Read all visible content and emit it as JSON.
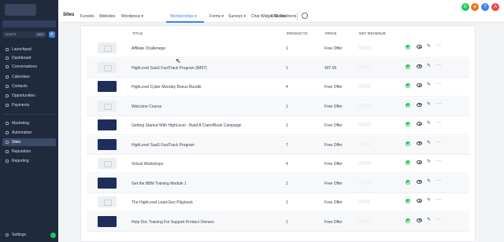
{
  "sidebar": {
    "search_placeholder": "Search",
    "search_shortcut": "ctrl K",
    "items": [
      {
        "label": "Launchpad",
        "icon": "rocket-icon"
      },
      {
        "label": "Dashboard",
        "icon": "dashboard-icon"
      },
      {
        "label": "Conversations",
        "icon": "chat-icon"
      },
      {
        "label": "Calendars",
        "icon": "calendar-icon"
      },
      {
        "label": "Contacts",
        "icon": "contacts-icon"
      },
      {
        "label": "Opportunities",
        "icon": "opportunities-icon"
      },
      {
        "label": "Payments",
        "icon": "payments-icon"
      },
      {
        "label": "Marketing",
        "icon": "marketing-icon"
      },
      {
        "label": "Automation",
        "icon": "automation-icon"
      },
      {
        "label": "Sites",
        "icon": "sites-icon"
      },
      {
        "label": "Reputation",
        "icon": "reputation-icon"
      },
      {
        "label": "Reporting",
        "icon": "reporting-icon"
      }
    ],
    "settings_label": "Settings"
  },
  "topbar": {
    "title": "Sites",
    "tabs": [
      "Funnels",
      "Websites",
      "Wordpress",
      "Memberships",
      "Forms",
      "Surveys",
      "Chat Widget",
      "Media",
      "URL Redirects"
    ],
    "dropdown_arrow": "▾"
  },
  "table": {
    "headers": {
      "title": "TITLE",
      "products": "PRODUCTS",
      "price": "PRICE",
      "revenue": "NET REVENUE"
    },
    "rows": [
      {
        "title": "Affiliate Challenege",
        "products": "1",
        "price": "Free Offer"
      },
      {
        "title": "HighLevel SaaS FastTrack Program ($497)",
        "products": "1",
        "price": "497.00"
      },
      {
        "title": "HighLevel Cyber Monday Bonus Bundle",
        "products": "4",
        "price": "Free Offer"
      },
      {
        "title": "Welcome Course",
        "products": "1",
        "price": "Free Offer"
      },
      {
        "title": "Getting Started With HighLevel - Build A Claim/Book Campaign",
        "products": "1",
        "price": "Free Offer"
      },
      {
        "title": "HighLevel SaaS FastTrack Program",
        "products": "7",
        "price": "Free Offer"
      },
      {
        "title": "Virtual Workshops",
        "products": "4",
        "price": "Free Offer"
      },
      {
        "title": "Get the BBM Training Module 1",
        "products": "1",
        "price": "Free Offer"
      },
      {
        "title": "The HighLevel Lead-Gen Playbook",
        "products": "1",
        "price": "Free Offer"
      },
      {
        "title": "Help Doc Training For Support Product Owners",
        "products": "1",
        "price": "Free Offer"
      }
    ]
  },
  "colors": {
    "accent": "#3b82f6",
    "sidebar": "#1f2a3d",
    "success": "#22c55e"
  }
}
